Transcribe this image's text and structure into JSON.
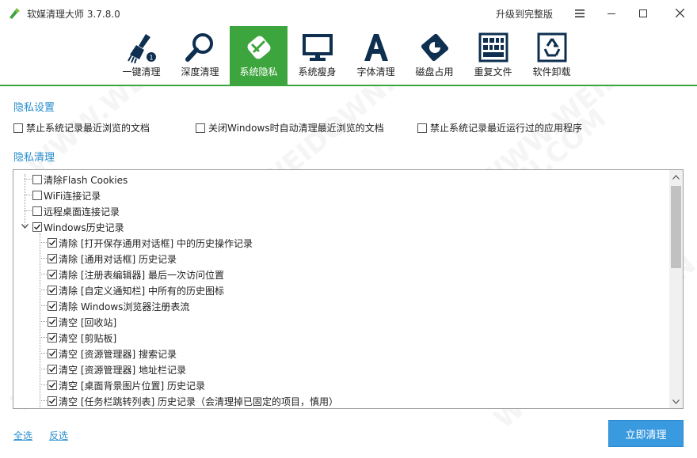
{
  "window": {
    "title": "软媒清理大师 3.7.8.0",
    "upgrade_label": "升级到完整版"
  },
  "toolbar": {
    "active_tab": "系统隐私",
    "accent_color": "#3da53d",
    "items": [
      {
        "label": "一键清理",
        "icon": "broom-icon"
      },
      {
        "label": "深度清理",
        "icon": "magnifier-icon"
      },
      {
        "label": "系统隐私",
        "icon": "privacy-shield-icon"
      },
      {
        "label": "系统瘦身",
        "icon": "monitor-icon"
      },
      {
        "label": "字体清理",
        "icon": "font-a-icon"
      },
      {
        "label": "磁盘占用",
        "icon": "disk-pie-icon"
      },
      {
        "label": "重复文件",
        "icon": "grid-files-icon"
      },
      {
        "label": "软件卸载",
        "icon": "recycle-icon"
      }
    ]
  },
  "privacy_settings": {
    "title": "隐私设置",
    "options": [
      {
        "label": "禁止系统记录最近浏览的文档",
        "checked": false
      },
      {
        "label": "关闭Windows时自动清理最近浏览的文档",
        "checked": false
      },
      {
        "label": "禁止系统记录最近运行过的应用程序",
        "checked": false
      }
    ]
  },
  "privacy_clean": {
    "title": "隐私清理",
    "top_items": [
      {
        "label": "清除Flash Cookies",
        "checked": false
      },
      {
        "label": "WiFi连接记录",
        "checked": false
      },
      {
        "label": "远程桌面连接记录",
        "checked": false
      }
    ],
    "group": {
      "label": "Windows历史记录",
      "checked": true,
      "expanded": true,
      "children": [
        {
          "label": "清除 [打开保存通用对话框] 中的历史操作记录",
          "checked": true
        },
        {
          "label": "清除 [通用对话框] 历史记录",
          "checked": true
        },
        {
          "label": "清除 [注册表编辑器] 最后一次访问位置",
          "checked": true
        },
        {
          "label": "清除 [自定义通知栏] 中所有的历史图标",
          "checked": true
        },
        {
          "label": "清除 Windows浏览器注册表流",
          "checked": true
        },
        {
          "label": "清空 [回收站]",
          "checked": true
        },
        {
          "label": "清空 [剪贴板]",
          "checked": true
        },
        {
          "label": "清空 [资源管理器] 搜索记录",
          "checked": true
        },
        {
          "label": "清空 [资源管理器] 地址栏记录",
          "checked": true
        },
        {
          "label": "清空 [桌面背景图片位置] 历史记录",
          "checked": true
        },
        {
          "label": "清空 [任务栏跳转列表] 历史记录（会清理掉已固定的项目，慎用）",
          "checked": true
        }
      ]
    }
  },
  "footer": {
    "select_all": "全选",
    "invert": "反选",
    "clean_now": "立即清理",
    "button_color": "#3a9ae0"
  },
  "watermark": "WWW.WEIDOWN.COM"
}
